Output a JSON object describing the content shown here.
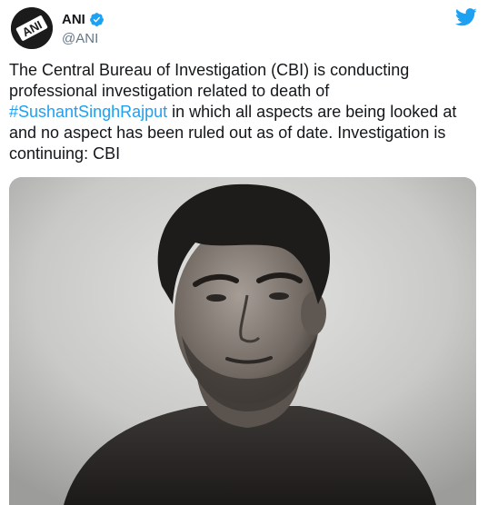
{
  "account": {
    "display_name": "ANI",
    "handle": "@ANI",
    "avatar_text": "ANI",
    "verified": true
  },
  "tweet": {
    "text_before": "The Central Bureau of Investigation (CBI) is conducting professional investigation related to death of ",
    "hashtag": "#SushantSinghRajput",
    "text_after": " in which all aspects are being looked at and no aspect has been ruled out as of date. Investigation is continuing: CBI"
  },
  "icons": {
    "verified": "verified-badge-icon",
    "brand": "twitter-bird-icon"
  },
  "colors": {
    "link": "#1da1f2",
    "verified": "#1da1f2",
    "text": "#14171a",
    "secondary": "#657786"
  }
}
